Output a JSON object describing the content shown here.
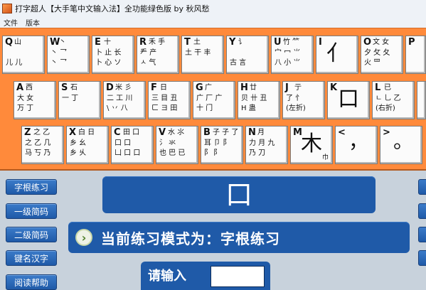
{
  "window": {
    "title": "打字超人【大手笔中文输入法】全功能绿色版 by 秋风愁"
  },
  "menu": {
    "items": [
      "文件",
      "版本"
    ]
  },
  "keyboard": {
    "keys": [
      {
        "letter": "Q",
        "c1": "山",
        "c2": "",
        "c3": "儿 儿"
      },
      {
        "letter": "W",
        "c1": "丶",
        "c2": "丶 乛",
        "c3": "丶 乛"
      },
      {
        "letter": "E",
        "c1": "十",
        "c2": "卜 止 长",
        "c3": "卜 心 ソ"
      },
      {
        "letter": "R",
        "c1": "禾 手",
        "c2": "龵 产",
        "c3": "ㅅ 气"
      },
      {
        "letter": "T",
        "c1": "土",
        "c2": "土 干 丰",
        "c3": ""
      },
      {
        "letter": "Y",
        "c1": "讠",
        "c2": "",
        "c3": "古 言"
      },
      {
        "letter": "U",
        "c1": "竹 ⺮",
        "c2": "宀 冖 ⺌",
        "c3": "八 小 ⺌"
      },
      {
        "letter": "I",
        "big": "亻",
        "c1": "",
        "c2": "",
        "c3": ""
      },
      {
        "letter": "O",
        "c1": "文 女",
        "c2": "夕 攵 夂",
        "c3": "火 罒"
      },
      {
        "letter": "P",
        "c1": "",
        "c2": "",
        "c3": ""
      },
      {
        "letter": "A",
        "c1": "西",
        "c2": "大 女",
        "c3": "万 丁"
      },
      {
        "letter": "S",
        "c1": "石",
        "c2": "一 丁",
        "c3": ""
      },
      {
        "letter": "D",
        "c1": "米 彡",
        "c2": "二 工 川",
        "c3": "\\ 丷 八"
      },
      {
        "letter": "F",
        "c1": "日",
        "c2": "三 目 丑",
        "c3": "ㄈ ヨ 田"
      },
      {
        "letter": "G",
        "c1": "广",
        "c2": "广 厂 广",
        "c3": "十 门"
      },
      {
        "letter": "H",
        "c1": "廿",
        "c2": "贝 卄 丑",
        "c3": "H 蛊"
      },
      {
        "letter": "J",
        "c1": "亍",
        "c2": "了 忄",
        "c3": "(左折)"
      },
      {
        "letter": "K",
        "big": "口",
        "c1": "",
        "c2": "",
        "c3": ""
      },
      {
        "letter": "L",
        "c1": "已",
        "c2": "ㄴ 乚 乙",
        "c3": "(右折)"
      },
      {
        "letter": "Z",
        "c1": "之 乙",
        "c2": "之 乙 几",
        "c3": "马 丂 乃"
      },
      {
        "letter": "X",
        "c1": "白 日",
        "c2": "乡 幺",
        "c3": "乡 乆"
      },
      {
        "letter": "C",
        "c1": "田 口",
        "c2": "口 口",
        "c3": "凵 口 口"
      },
      {
        "letter": "V",
        "c1": "水 ⺢",
        "c2": "氵 氺",
        "c3": "也 巴 已"
      },
      {
        "letter": "B",
        "c1": "子 子 了",
        "c2": "耳 卩 阝",
        "c3": "阝 阝"
      },
      {
        "letter": "N",
        "c1": "月",
        "c2": "力 月 九",
        "c3": "乃 刀"
      },
      {
        "letter": "M",
        "big": "木",
        "sub": "巾",
        "c1": "",
        "c2": "",
        "c3": ""
      },
      {
        "letter": "<",
        "punct": "，",
        "c1": "",
        "c2": "",
        "c3": ""
      },
      {
        "letter": ">",
        "punct": "。",
        "c1": "",
        "c2": "",
        "c3": ""
      }
    ]
  },
  "left_menu": {
    "items": [
      {
        "label": "字根练习"
      },
      {
        "label": "一级简码"
      },
      {
        "label": "二级简码"
      },
      {
        "label": "键名汉字"
      },
      {
        "label": "阅读帮助"
      }
    ]
  },
  "main": {
    "current_char": "口",
    "mode_text": "当前练习模式为：字根练习",
    "input_label": "请输入",
    "input_value": ""
  },
  "colors": {
    "keyboard_bg": "#ff8a3b",
    "panel_blue": "#1f5aa8",
    "body_bg": "#c8d2dc"
  }
}
